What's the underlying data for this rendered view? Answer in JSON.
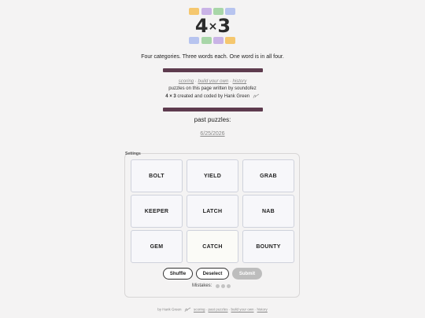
{
  "logo": {
    "text_left": "4",
    "text_x": "×",
    "text_right": "3",
    "colors": [
      "#f5c76e",
      "#c9b3e6",
      "#a8d6a8",
      "#b7c4ef"
    ]
  },
  "tagline": "Four categories. Three words each. One word is in all four.",
  "links": {
    "scoring": "scoring",
    "sep1": " · ",
    "build": "build your own",
    "sep2": " · ",
    "history": "history"
  },
  "credits": {
    "line1": "puzzles on this page written by soundofez",
    "line2_bold": "4 × 3",
    "line2_rest": " created and coded by Hank Green"
  },
  "past": {
    "title": "past puzzles:",
    "date": "6/25/2026"
  },
  "settings_label": "Settings",
  "tiles": [
    "BOLT",
    "YIELD",
    "GRAB",
    "KEEPER",
    "LATCH",
    "NAB",
    "GEM",
    "CATCH",
    "BOUNTY"
  ],
  "buttons": {
    "shuffle": "Shuffle",
    "deselect": "Deselect",
    "submit": "Submit"
  },
  "mistakes_label": "Mistakes:",
  "mistakes_remaining": 3,
  "footer": {
    "by": "by Hank Green",
    "sep": " · ",
    "scoring": "scoring",
    "past": "past puzzles",
    "build": "build your own",
    "history": "history"
  }
}
